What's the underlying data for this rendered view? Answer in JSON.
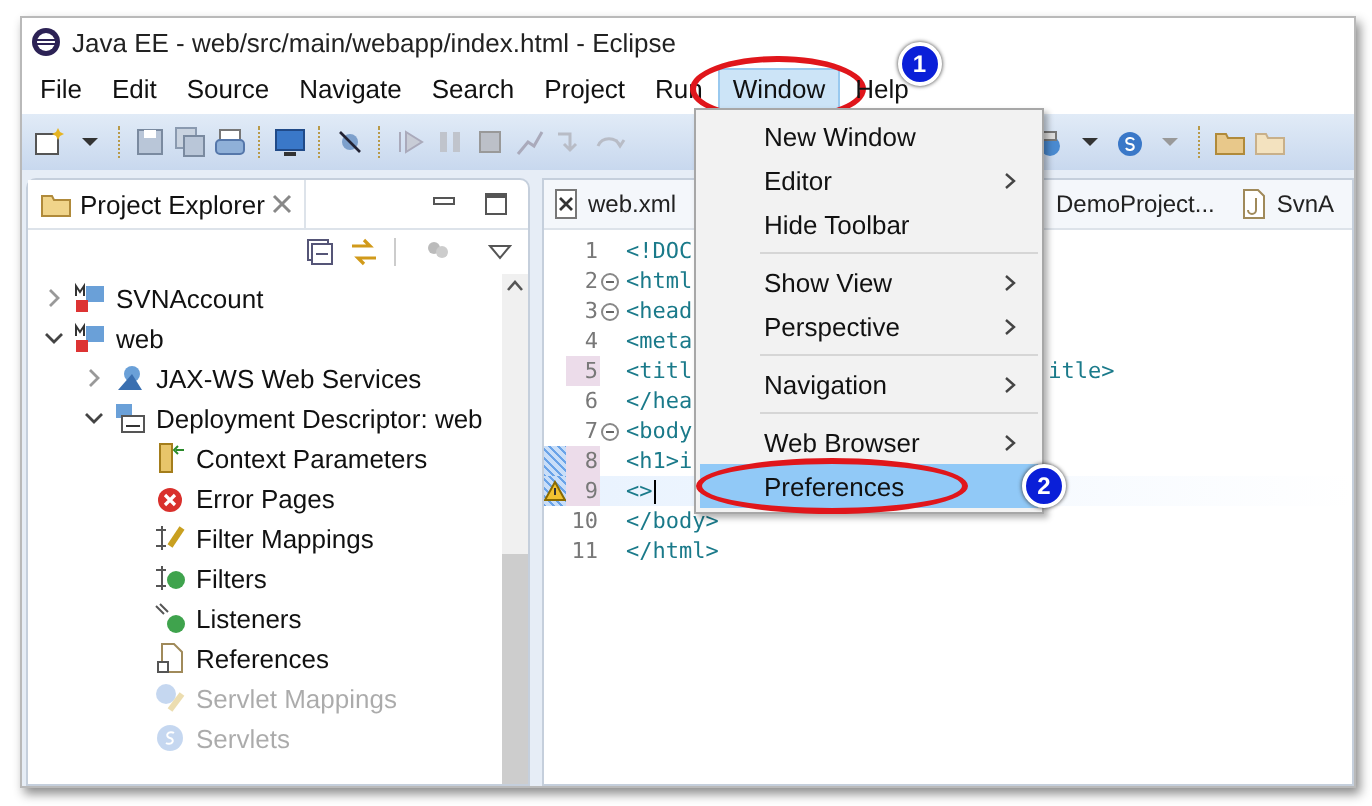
{
  "window": {
    "title": "Java EE - web/src/main/webapp/index.html - Eclipse"
  },
  "menu_bar": [
    {
      "label": "File",
      "selected": false
    },
    {
      "label": "Edit",
      "selected": false
    },
    {
      "label": "Source",
      "selected": false
    },
    {
      "label": "Navigate",
      "selected": false
    },
    {
      "label": "Search",
      "selected": false
    },
    {
      "label": "Project",
      "selected": false
    },
    {
      "label": "Run",
      "selected": false
    },
    {
      "label": "Window",
      "selected": true,
      "badge": "1"
    },
    {
      "label": "Help",
      "selected": false
    }
  ],
  "project_explorer": {
    "title": "Project Explorer",
    "tree": [
      {
        "label": "SVNAccount",
        "kind": "project",
        "expanded": false
      },
      {
        "label": "web",
        "kind": "project",
        "expanded": true,
        "children": [
          {
            "label": "JAX-WS Web Services",
            "kind": "services",
            "expanded": false
          },
          {
            "label": "Deployment Descriptor: web",
            "kind": "descriptor",
            "expanded": true,
            "children": [
              {
                "label": "Context Parameters",
                "kind": "params",
                "dimmed": false
              },
              {
                "label": "Error Pages",
                "kind": "error",
                "dimmed": false
              },
              {
                "label": "Filter Mappings",
                "kind": "filter-mapping",
                "dimmed": false
              },
              {
                "label": "Filters",
                "kind": "filter",
                "dimmed": false
              },
              {
                "label": "Listeners",
                "kind": "listener",
                "dimmed": false
              },
              {
                "label": "References",
                "kind": "reference",
                "dimmed": false
              },
              {
                "label": "Servlet Mappings",
                "kind": "servlet-mapping",
                "dimmed": true
              },
              {
                "label": "Servlets",
                "kind": "servlet",
                "dimmed": true
              }
            ]
          }
        ]
      }
    ]
  },
  "editor": {
    "tabs": [
      {
        "label": "web.xml",
        "kind": "xml"
      },
      {
        "label": "DemoProject...",
        "kind": "none"
      },
      {
        "label": "SvnA",
        "kind": "java"
      }
    ],
    "lines": [
      {
        "number": "1",
        "text": "<!DOC",
        "foldable": false,
        "changed": false,
        "hatched": false,
        "warning": false,
        "current": false
      },
      {
        "number": "2",
        "text": "<html",
        "foldable": true,
        "changed": false,
        "hatched": false,
        "warning": false,
        "current": false
      },
      {
        "number": "3",
        "text": "<head",
        "foldable": true,
        "changed": false,
        "hatched": false,
        "warning": false,
        "current": false
      },
      {
        "number": "4",
        "text": "<meta",
        "foldable": false,
        "changed": false,
        "hatched": false,
        "warning": false,
        "current": false
      },
      {
        "number": "5",
        "text": "<titl",
        "tail": "itle>",
        "foldable": false,
        "changed": true,
        "hatched": false,
        "warning": false,
        "current": false
      },
      {
        "number": "6",
        "text": "</hea",
        "foldable": false,
        "changed": false,
        "hatched": false,
        "warning": false,
        "current": false
      },
      {
        "number": "7",
        "text": "<body",
        "foldable": true,
        "changed": false,
        "hatched": false,
        "warning": false,
        "current": false
      },
      {
        "number": "8",
        "text": "<h1>i",
        "foldable": false,
        "changed": true,
        "hatched": true,
        "warning": false,
        "current": false
      },
      {
        "number": "9",
        "text": "<>",
        "foldable": false,
        "changed": true,
        "hatched": true,
        "warning": true,
        "current": true
      },
      {
        "number": "10",
        "text": "</body>",
        "foldable": false,
        "changed": false,
        "hatched": false,
        "warning": false,
        "current": false
      },
      {
        "number": "11",
        "text": "</html>",
        "foldable": false,
        "changed": false,
        "hatched": false,
        "warning": false,
        "current": false
      }
    ]
  },
  "window_menu": [
    {
      "kind": "item",
      "label": "New Window",
      "submenu": false,
      "selected": false
    },
    {
      "kind": "item",
      "label": "Editor",
      "submenu": true,
      "selected": false
    },
    {
      "kind": "item",
      "label": "Hide Toolbar",
      "submenu": false,
      "selected": false
    },
    {
      "kind": "separator"
    },
    {
      "kind": "item",
      "label": "Show View",
      "submenu": true,
      "selected": false
    },
    {
      "kind": "item",
      "label": "Perspective",
      "submenu": true,
      "selected": false
    },
    {
      "kind": "separator"
    },
    {
      "kind": "item",
      "label": "Navigation",
      "submenu": true,
      "selected": false
    },
    {
      "kind": "separator"
    },
    {
      "kind": "item",
      "label": "Web Browser",
      "submenu": true,
      "selected": false
    },
    {
      "kind": "item",
      "label": "Preferences",
      "submenu": false,
      "selected": true,
      "badge": "2"
    }
  ]
}
